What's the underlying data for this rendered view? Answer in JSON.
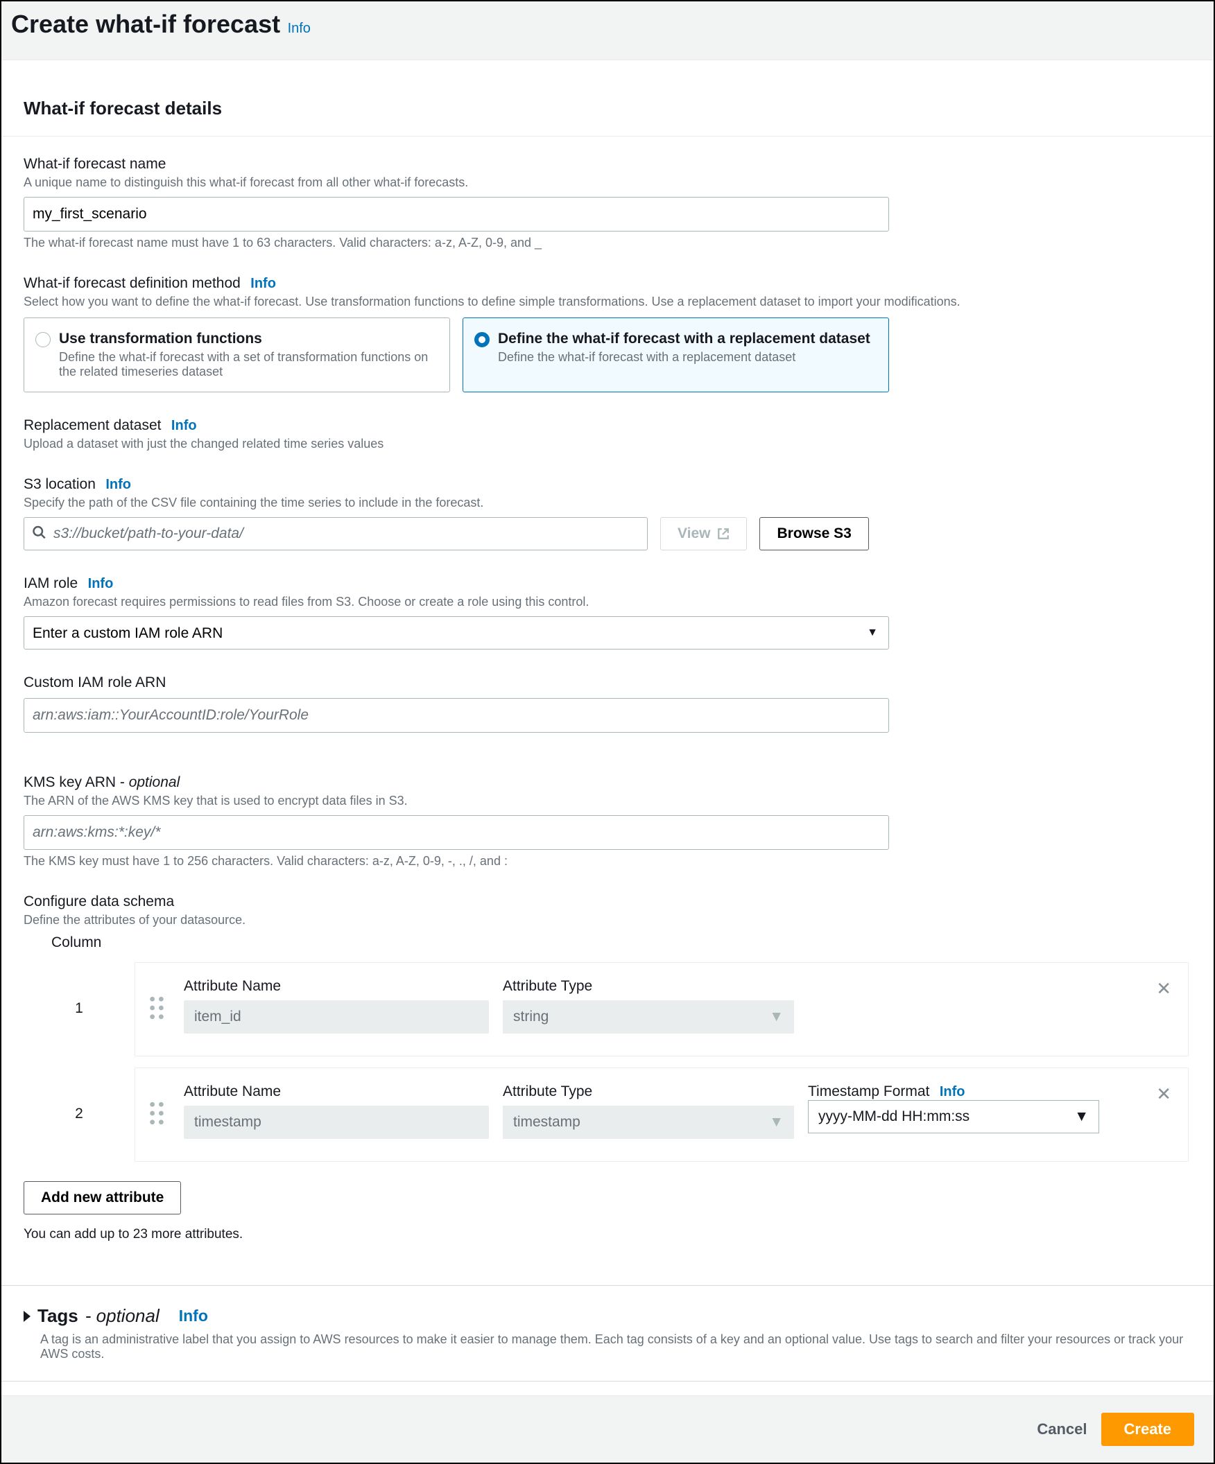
{
  "header": {
    "title": "Create what-if forecast",
    "info": "Info"
  },
  "panel": {
    "title": "What-if forecast details",
    "name": {
      "label": "What-if forecast name",
      "desc": "A unique name to distinguish this what-if forecast from all other what-if forecasts.",
      "value": "my_first_scenario",
      "hint": "The what-if forecast name must have 1 to 63 characters. Valid characters: a-z, A-Z, 0-9, and _"
    },
    "method": {
      "label": "What-if forecast definition method",
      "info": "Info",
      "desc": "Select how you want to define the what-if forecast. Use transformation functions to define simple transformations. Use a replacement dataset to import your modifications.",
      "options": [
        {
          "title": "Use transformation functions",
          "desc": "Define the what-if forecast with a set of transformation functions on the related timeseries dataset",
          "selected": false
        },
        {
          "title": "Define the what-if forecast with a replacement dataset",
          "desc": "Define the what-if forecast with a replacement dataset",
          "selected": true
        }
      ]
    },
    "replacement": {
      "label": "Replacement dataset",
      "info": "Info",
      "desc": "Upload a dataset with just the changed related time series values"
    },
    "s3": {
      "label": "S3 location",
      "info": "Info",
      "desc": "Specify the path of the CSV file containing the time series to include in the forecast.",
      "placeholder": "s3://bucket/path-to-your-data/",
      "view": "View",
      "browse": "Browse S3"
    },
    "iam": {
      "label": "IAM role",
      "info": "Info",
      "desc": "Amazon forecast requires permissions to read files from S3. Choose or create a role using this control.",
      "selected": "Enter a custom IAM role ARN"
    },
    "customArn": {
      "label": "Custom IAM role ARN",
      "placeholder": "arn:aws:iam::YourAccountID:role/YourRole"
    },
    "kms": {
      "label_main": "KMS key ARN - ",
      "label_opt": "optional",
      "desc": "The ARN of the AWS KMS key that is used to encrypt data files in S3.",
      "placeholder": "arn:aws:kms:*:key/*",
      "hint": "The KMS key must have 1 to 256 characters. Valid characters: a-z, A-Z, 0-9, -, ., /, and :"
    },
    "schema": {
      "label": "Configure data schema",
      "desc": "Define the attributes of your datasource.",
      "col_header": "Column",
      "attr_name_label": "Attribute Name",
      "attr_type_label": "Attribute Type",
      "ts_format_label": "Timestamp Format",
      "ts_info": "Info",
      "rows": [
        {
          "num": "1",
          "name": "item_id",
          "type": "string"
        },
        {
          "num": "2",
          "name": "timestamp",
          "type": "timestamp",
          "ts_format": "yyyy-MM-dd HH:mm:ss"
        }
      ],
      "add_btn": "Add new attribute",
      "remaining_hint": "You can add up to 23 more attributes."
    }
  },
  "tags": {
    "title": "Tags",
    "opt": " - optional",
    "info": "Info",
    "desc": "A tag is an administrative label that you assign to AWS resources to make it easier to manage them. Each tag consists of a key and an optional value. Use tags to search and filter your resources or track your AWS costs."
  },
  "footer": {
    "cancel": "Cancel",
    "create": "Create"
  }
}
